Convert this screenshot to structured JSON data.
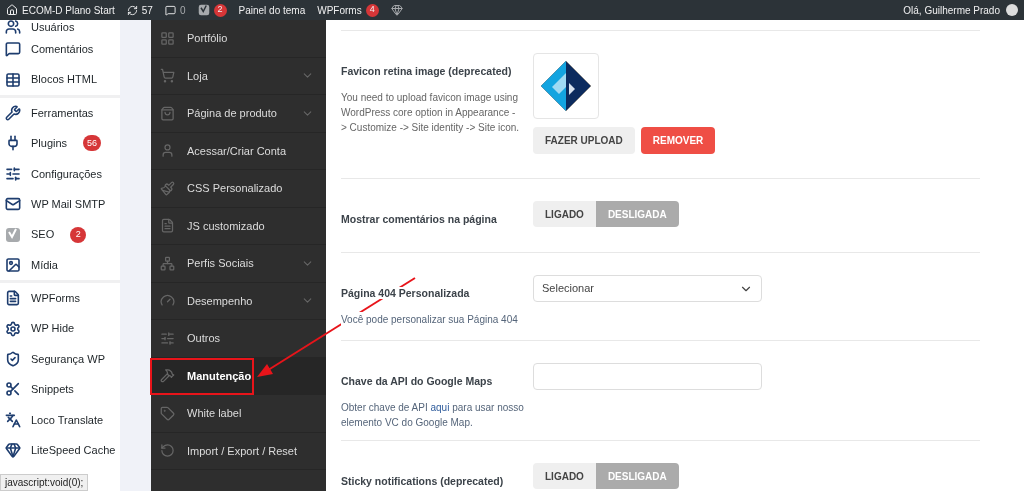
{
  "admin_bar": {
    "site": "ECOM-D Plano Start",
    "updates": "57",
    "comments": "0",
    "seo_badge": "2",
    "theme_panel": "Painel do tema",
    "wpforms": "WPForms",
    "wpforms_badge": "4",
    "greeting": "Olá, Guilherme Prado"
  },
  "sidebar": {
    "items": [
      {
        "label": "Usuários",
        "separator_after": false
      },
      {
        "label": "Comentários",
        "separator_after": false
      },
      {
        "label": "Blocos HTML",
        "separator_after": true
      },
      {
        "label": "Ferramentas",
        "separator_after": false
      },
      {
        "label": "Plugins",
        "badge": "56",
        "separator_after": false
      },
      {
        "label": "Configurações",
        "separator_after": false
      },
      {
        "label": "WP Mail SMTP",
        "separator_after": false
      },
      {
        "label": "SEO",
        "badge": "2",
        "separator_after": false
      },
      {
        "label": "Mídia",
        "separator_after": true
      },
      {
        "label": "WPForms",
        "separator_after": false
      },
      {
        "label": "WP Hide",
        "separator_after": false
      },
      {
        "label": "Segurança WP",
        "separator_after": false
      },
      {
        "label": "Snippets",
        "separator_after": false
      },
      {
        "label": "Loco Translate",
        "separator_after": false
      },
      {
        "label": "LiteSpeed Cache",
        "separator_after": false
      }
    ]
  },
  "status_tooltip": "javascript:void(0);",
  "theme_menu": {
    "items": [
      {
        "label": "Portfólio",
        "expandable": false,
        "selected": false
      },
      {
        "label": "Loja",
        "expandable": true,
        "selected": false
      },
      {
        "label": "Página de produto",
        "expandable": true,
        "selected": false
      },
      {
        "label": "Acessar/Criar Conta",
        "expandable": false,
        "selected": false
      },
      {
        "label": "CSS Personalizado",
        "expandable": false,
        "selected": false
      },
      {
        "label": "JS customizado",
        "expandable": false,
        "selected": false
      },
      {
        "label": "Perfis Sociais",
        "expandable": true,
        "selected": false
      },
      {
        "label": "Desempenho",
        "expandable": true,
        "selected": false
      },
      {
        "label": "Outros",
        "expandable": false,
        "selected": false
      },
      {
        "label": "Manutenção",
        "expandable": false,
        "selected": true
      },
      {
        "label": "White label",
        "expandable": false,
        "selected": false
      },
      {
        "label": "Import / Export / Reset",
        "expandable": false,
        "selected": false
      }
    ]
  },
  "settings": [
    {
      "kind": "image-upload",
      "label": "Favicon retina image (deprecated)",
      "description": "You need to upload favicon image using WordPress core option in Appearance -> Customize -> Site identity -> Site icon.",
      "upload_button": "FAZER UPLOAD",
      "remove_button": "REMOVER"
    },
    {
      "kind": "toggle",
      "label": "Mostrar comentários na página",
      "options": [
        {
          "label": "LIGADO",
          "selected": false
        },
        {
          "label": "DESLIGADA",
          "selected": true
        }
      ]
    },
    {
      "kind": "select",
      "label": "Página 404 Personalizada",
      "description": "Você pode personalizar sua Página 404",
      "value": "Selecionar"
    },
    {
      "kind": "text-input",
      "label": "Chave da API do Google Maps",
      "description_before": "Obter chave de API ",
      "link": "aqui",
      "description_after": " para usar nosso elemento VC do Google Map."
    },
    {
      "kind": "toggle",
      "label": "Sticky notifications (deprecated)",
      "options": [
        {
          "label": "LIGADO",
          "selected": false
        },
        {
          "label": "DESLIGADA",
          "selected": true
        }
      ]
    }
  ]
}
